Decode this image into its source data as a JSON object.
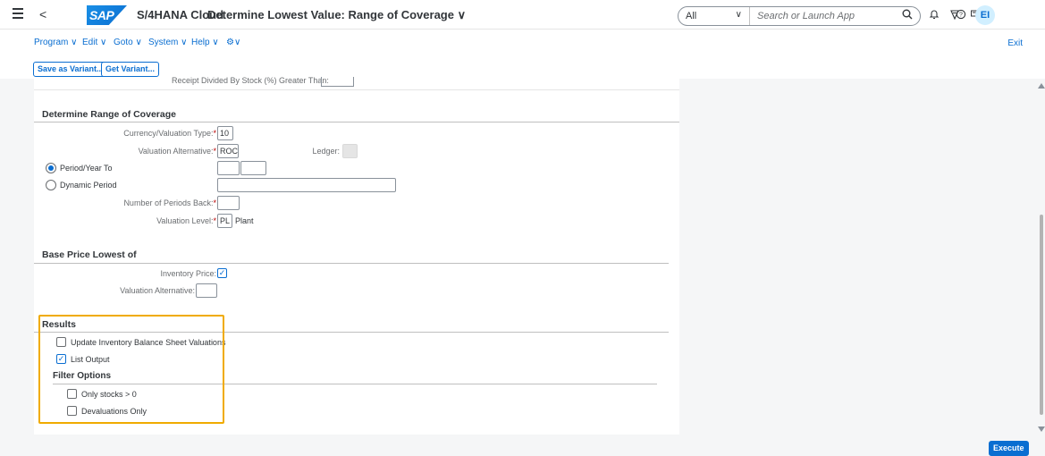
{
  "shell": {
    "product": "S/4HANA Cloud",
    "app_title": "Determine Lowest Value: Range of Coverage",
    "title_chevron": "∨",
    "back_glyph": "<",
    "logo_text": "SAP",
    "search_scope": "All",
    "search_placeholder": "Search or Launch App",
    "user_initials": "EI"
  },
  "menu": {
    "items": [
      "Program ∨",
      "Edit ∨",
      "Goto ∨",
      "System ∨",
      "Help ∨",
      "⚙∨"
    ],
    "exit": "Exit"
  },
  "toolbar": {
    "save_variant": "Save as Variant...",
    "get_variant": "Get Variant..."
  },
  "top_cut": {
    "label": "Receipt Divided By Stock (%) Greater Than:"
  },
  "range_section": {
    "title": "Determine Range of Coverage",
    "currency_label": "Currency/Valuation Type:",
    "currency_value": "10",
    "valuation_alt_label": "Valuation Alternative:",
    "valuation_alt_value": "ROC",
    "ledger_label": "Ledger:",
    "period_year_label": "Period/Year To",
    "dynamic_period_label": "Dynamic Period",
    "periods_back_label": "Number of Periods Back:",
    "valuation_level_label": "Valuation Level:",
    "valuation_level_value": "PL",
    "valuation_level_text": "Plant",
    "required_mark": "*"
  },
  "base_price_section": {
    "title": "Base Price Lowest of",
    "inventory_price_label": "Inventory Price:",
    "valuation_alt_label": "Valuation Alternative:"
  },
  "results_section": {
    "title": "Results",
    "update_label": "Update Inventory Balance Sheet Valuations",
    "list_output_label": "List Output",
    "filter_title": "Filter Options",
    "only_stocks_label": "Only stocks > 0",
    "devaluations_label": "Devaluations Only"
  },
  "footer": {
    "execute": "Execute"
  },
  "icons": {
    "check_glyph": "✓",
    "search_glyph": "⌕",
    "bell_glyph": "🔔",
    "help_glyph": "?"
  }
}
